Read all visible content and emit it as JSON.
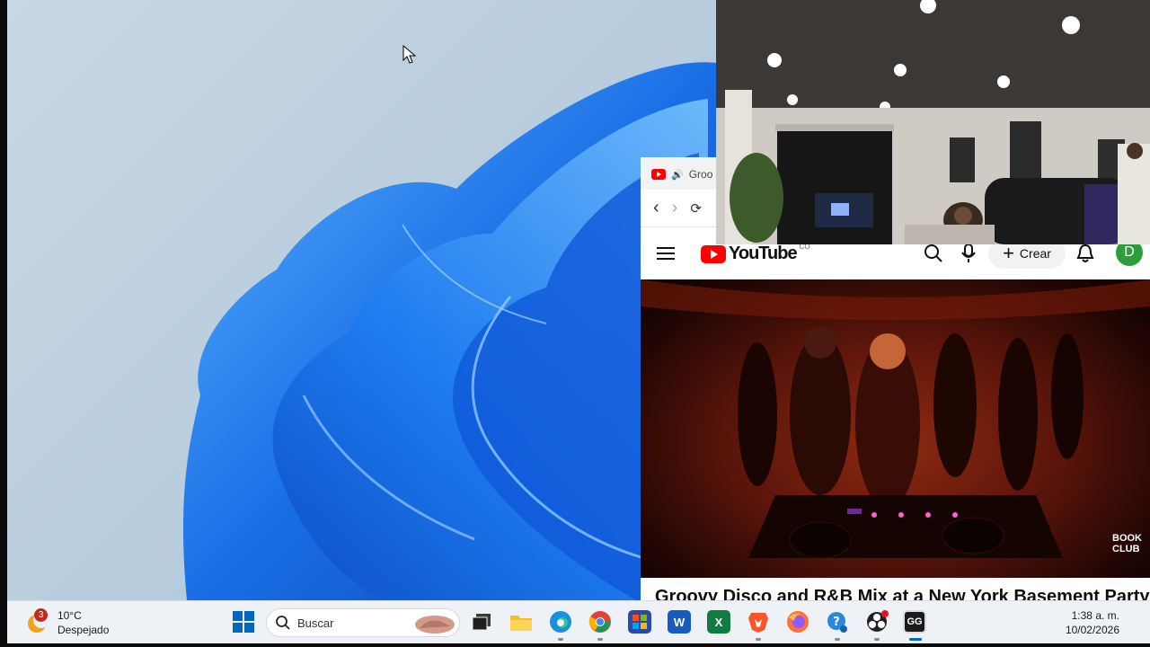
{
  "browser": {
    "tab_title": "Groo",
    "tab_icon": "youtube-favicon-icon",
    "audio_icon": "speaker-icon"
  },
  "youtube": {
    "logo_text": "YouTube",
    "logo_badge": "CO",
    "create_label": "Crear",
    "avatar_letter": "D",
    "video_watermark": "BOOK CLUB",
    "video_title": "Groovy Disco and R&B Mix at a New York Basement Party |"
  },
  "taskbar": {
    "weather_badge": "3",
    "temperature": "10°C",
    "condition": "Despejado",
    "search_placeholder": "Buscar",
    "time": "1:38 a. m.",
    "date": "10/02/2026",
    "apps": [
      "start-icon",
      "task-view-icon",
      "file-explorer-icon",
      "edge-icon",
      "chrome-icon",
      "microsoft-store-icon",
      "word-icon",
      "excel-icon",
      "brave-icon",
      "firefox-icon",
      "get-help-icon",
      "obs-icon",
      "gg-app-icon"
    ]
  },
  "colors": {
    "youtube_red": "#ff0000",
    "avatar_green": "#2e9e3a",
    "windows_blue": "#0067c0"
  }
}
